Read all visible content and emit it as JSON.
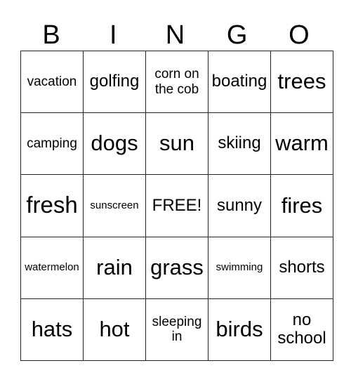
{
  "header": {
    "letters": [
      "B",
      "I",
      "N",
      "G",
      "O"
    ]
  },
  "card": {
    "rows": [
      [
        {
          "text": "vacation",
          "size": "s-sm"
        },
        {
          "text": "golfing",
          "size": "s-md"
        },
        {
          "text": "corn on the cob",
          "size": "s-sm"
        },
        {
          "text": "boating",
          "size": "s-md"
        },
        {
          "text": "trees",
          "size": "s-lg"
        }
      ],
      [
        {
          "text": "camping",
          "size": "s-sm"
        },
        {
          "text": "dogs",
          "size": "s-lg"
        },
        {
          "text": "sun",
          "size": "s-lg"
        },
        {
          "text": "skiing",
          "size": "s-md"
        },
        {
          "text": "warm",
          "size": "s-lg"
        }
      ],
      [
        {
          "text": "fresh",
          "size": "s-xl"
        },
        {
          "text": "sunscreen",
          "size": "s-xs"
        },
        {
          "text": "FREE!",
          "size": "s-md"
        },
        {
          "text": "sunny",
          "size": "s-md"
        },
        {
          "text": "fires",
          "size": "s-lg"
        }
      ],
      [
        {
          "text": "watermelon",
          "size": "s-xs"
        },
        {
          "text": "rain",
          "size": "s-lg"
        },
        {
          "text": "grass",
          "size": "s-lg"
        },
        {
          "text": "swimming",
          "size": "s-xs"
        },
        {
          "text": "shorts",
          "size": "s-md"
        }
      ],
      [
        {
          "text": "hats",
          "size": "s-lg"
        },
        {
          "text": "hot",
          "size": "s-lg"
        },
        {
          "text": "sleeping in",
          "size": "s-sm"
        },
        {
          "text": "birds",
          "size": "s-lg"
        },
        {
          "text": "no school",
          "size": "s-md"
        }
      ]
    ]
  }
}
